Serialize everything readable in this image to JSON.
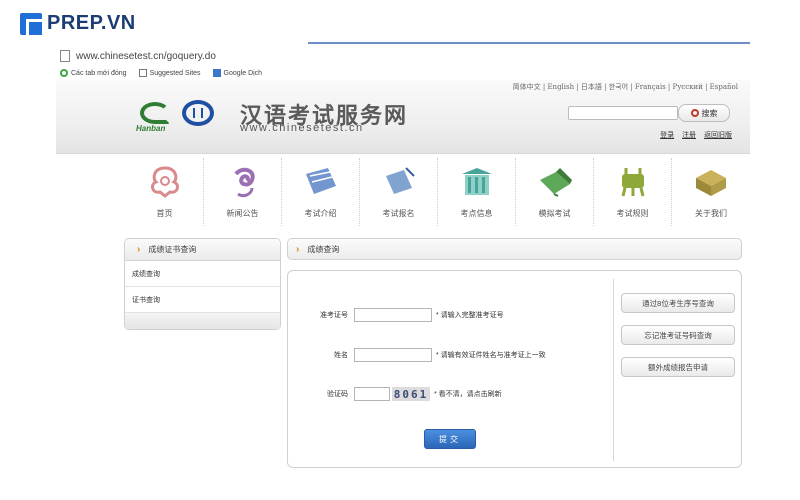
{
  "watermark": {
    "brand": "PREP.VN"
  },
  "browser": {
    "url": "www.chinesetest.cn/goquery.do",
    "bookmarks": [
      {
        "label": "Các tab mới đóng",
        "icon": "recent-tabs-icon"
      },
      {
        "label": "Suggested Sites",
        "icon": "page-icon"
      },
      {
        "label": "Google Dịch",
        "icon": "translate-icon"
      }
    ]
  },
  "header": {
    "hanban_logo_text": "Hanban",
    "title": "汉语考试服务网",
    "url": "www.chinesetest.cn",
    "languages": "简体中文 | English | 日本語 | 한국어 | Français | Русский | Español",
    "search_button": "搜索",
    "login": "登录",
    "register": "注册",
    "old_version": "返回旧版"
  },
  "nav": [
    {
      "label": "首页",
      "icon": "home-knot-icon",
      "color": "#d98a8a"
    },
    {
      "label": "新闻公告",
      "icon": "news-swirl-icon",
      "color": "#9b6fb3"
    },
    {
      "label": "考试介绍",
      "icon": "scroll-icon",
      "color": "#5a83c8"
    },
    {
      "label": "考试报名",
      "icon": "register-scroll-icon",
      "color": "#6a93c8"
    },
    {
      "label": "考点信息",
      "icon": "building-icon",
      "color": "#4aa39a"
    },
    {
      "label": "模拟考试",
      "icon": "book-icon",
      "color": "#5ea85a"
    },
    {
      "label": "考试规则",
      "icon": "ding-vessel-icon",
      "color": "#8fa83a"
    },
    {
      "label": "关于我们",
      "icon": "box-icon",
      "color": "#9a8a3a"
    }
  ],
  "sidebar": {
    "title": "成绩证书查询",
    "items": [
      "成绩查询",
      "证书查询"
    ]
  },
  "main": {
    "breadcrumb": "成绩查询",
    "form": {
      "exam_id_label": "准考证号",
      "exam_id_value": "",
      "exam_id_hint": "* 请输入完整准考证号",
      "name_label": "姓名",
      "name_value": "",
      "name_hint": "* 请输有效证件姓名与准考证上一致",
      "captcha_label": "验证码",
      "captcha_value": "",
      "captcha_text": "8061",
      "captcha_hint": "* 看不清，请点击刷新",
      "submit": "提交"
    },
    "side_buttons": [
      "通过8位考生序号查询",
      "忘记准考证号码查询",
      "额外成绩报告申请"
    ]
  }
}
